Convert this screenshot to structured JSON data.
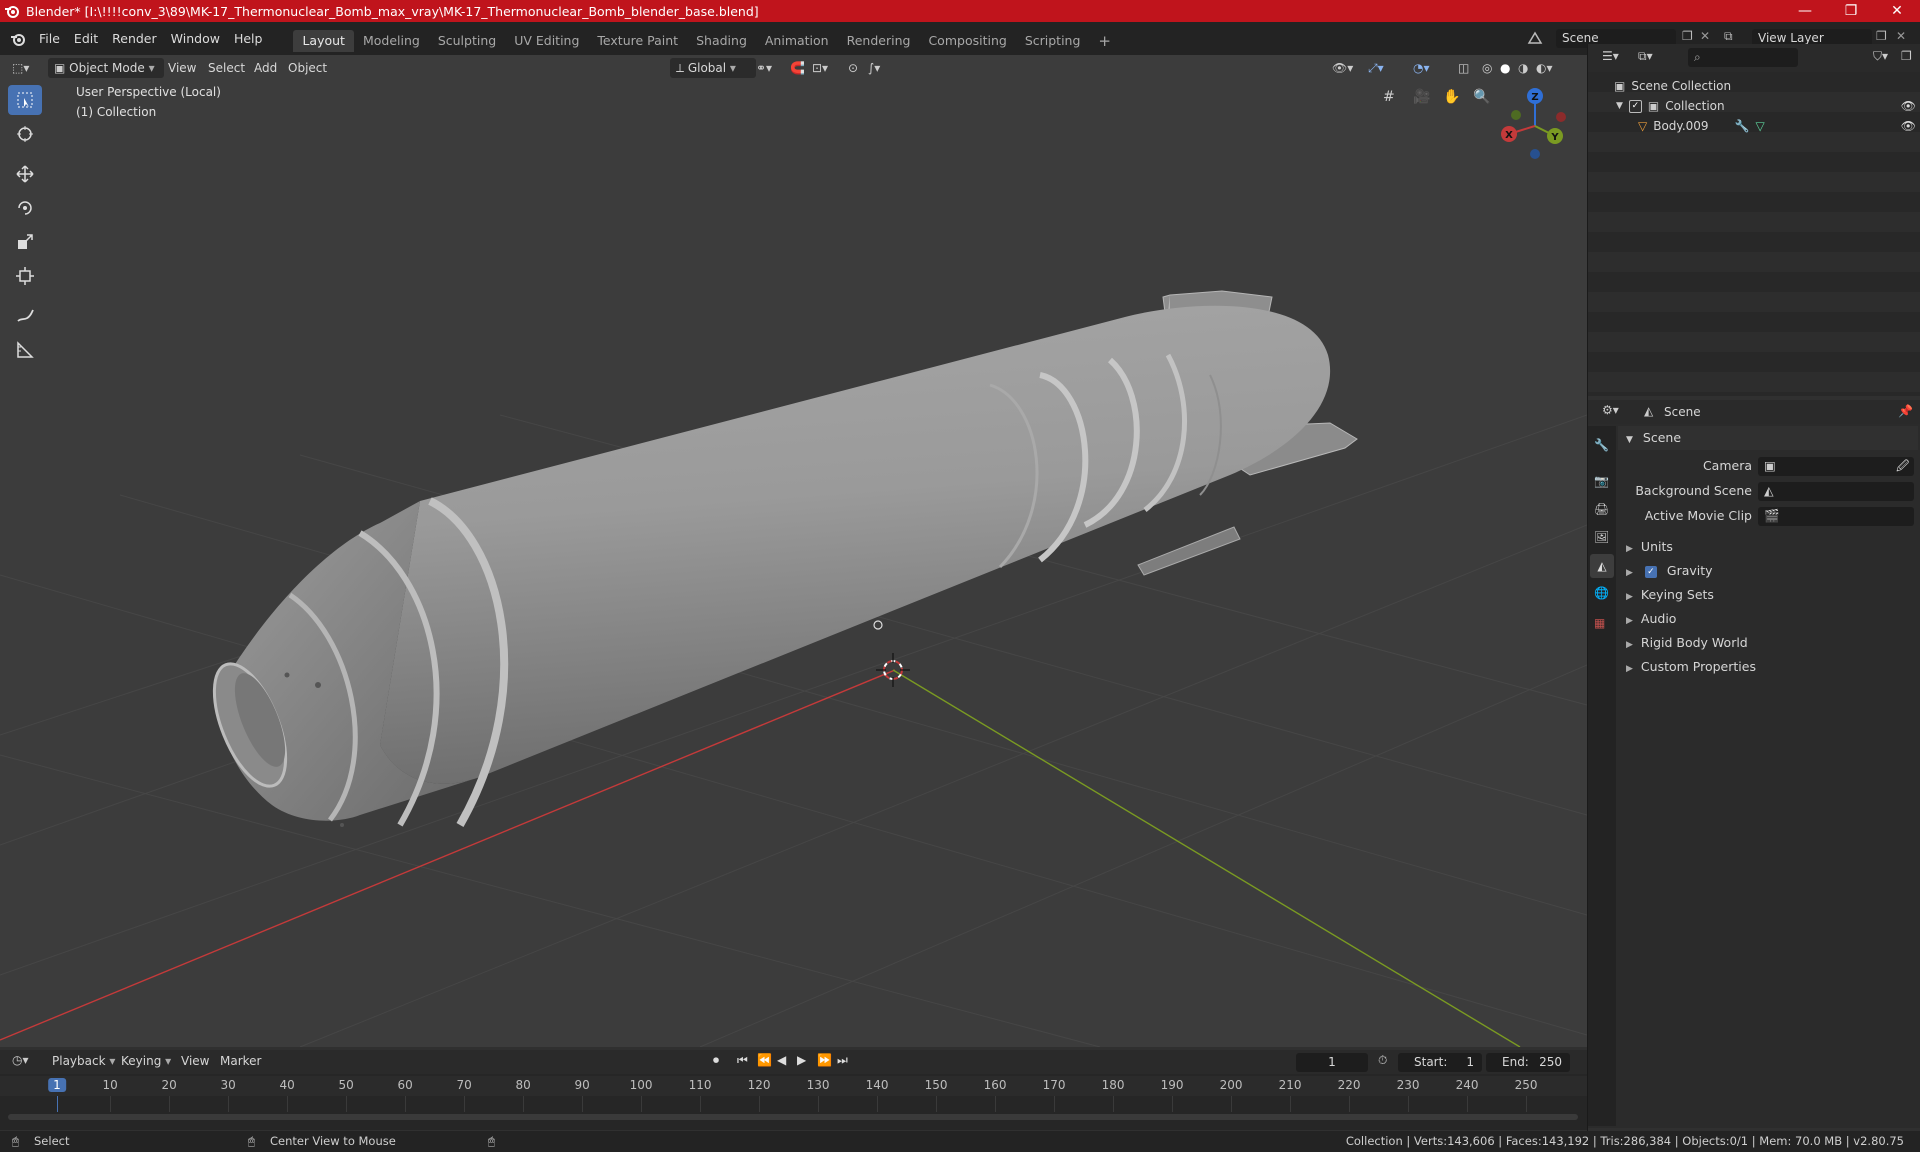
{
  "window": {
    "title": "Blender* [I:\\!!!!conv_3\\89\\MK-17_Thermonuclear_Bomb_max_vray\\MK-17_Thermonuclear_Bomb_blender_base.blend]",
    "buttons": [
      "—",
      "❐",
      "✕"
    ]
  },
  "menu": {
    "items": [
      "File",
      "Edit",
      "Render",
      "Window",
      "Help"
    ]
  },
  "workspaces": {
    "tabs": [
      "Layout",
      "Modeling",
      "Sculpting",
      "UV Editing",
      "Texture Paint",
      "Shading",
      "Animation",
      "Rendering",
      "Compositing",
      "Scripting"
    ],
    "active": "Layout",
    "add_label": "+"
  },
  "scene_selector": {
    "value": "Scene"
  },
  "viewlayer_selector": {
    "value": "View Layer"
  },
  "viewport_header": {
    "mode": "Object Mode",
    "menus": [
      "View",
      "Select",
      "Add",
      "Object"
    ],
    "orientation": "Global"
  },
  "viewport": {
    "perspective_label": "User Perspective (Local)",
    "collection_label": "(1) Collection",
    "gizmo_axes": {
      "x": "X",
      "y": "Y",
      "z": "Z"
    }
  },
  "outliner": {
    "root": "Scene Collection",
    "collection": "Collection",
    "object": "Body.009"
  },
  "properties": {
    "tab_title": "Scene",
    "panel_title": "Scene",
    "fields": [
      {
        "label": "Camera",
        "value": ""
      },
      {
        "label": "Background Scene",
        "value": ""
      },
      {
        "label": "Active Movie Clip",
        "value": ""
      }
    ],
    "subpanels": [
      "Units",
      "Gravity",
      "Keying Sets",
      "Audio",
      "Rigid Body World",
      "Custom Properties"
    ],
    "gravity_checked": true
  },
  "timeline": {
    "menus": [
      "Playback",
      "Keying",
      "View",
      "Marker"
    ],
    "current_frame": "1",
    "start_label": "Start:",
    "start_value": "1",
    "end_label": "End:",
    "end_value": "250",
    "ruler": [
      "1",
      "10",
      "20",
      "30",
      "40",
      "50",
      "60",
      "70",
      "80",
      "90",
      "100",
      "110",
      "120",
      "130",
      "140",
      "150",
      "160",
      "170",
      "180",
      "190",
      "200",
      "210",
      "220",
      "230",
      "240",
      "250"
    ]
  },
  "statusbar": {
    "left_action": "Select",
    "middle_action": "Center View to Mouse",
    "stats": "Collection | Verts:143,606 | Faces:143,192 | Tris:286,384 | Objects:0/1 | Mem: 70.0 MB | v2.80.75"
  },
  "colors": {
    "title_bar": "#c0141c",
    "accent": "#4772b3",
    "x_axis": "#c43a3a",
    "y_axis": "#7a9a22",
    "z_axis": "#2f6fd6"
  }
}
